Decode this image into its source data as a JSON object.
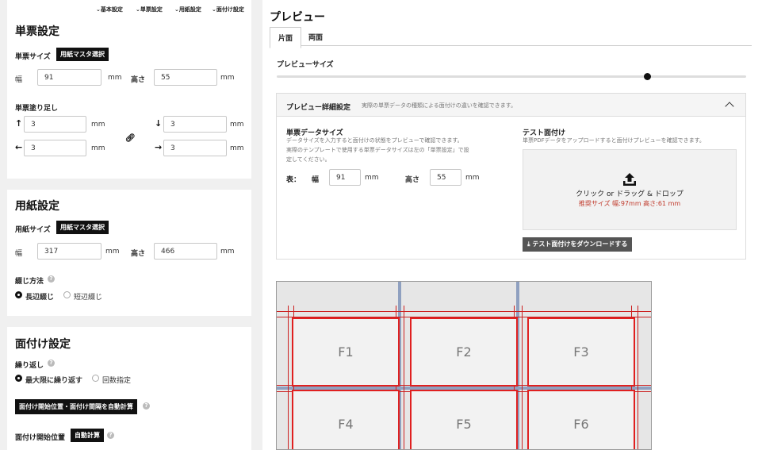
{
  "nav": {
    "basic": "基本設定",
    "ticket": "単票設定",
    "paper": "用紙設定",
    "imposition": "面付け設定"
  },
  "ticket": {
    "title": "単票設定",
    "size_label": "単票サイズ",
    "master_btn": "用紙マスタ選択",
    "width_label": "幅",
    "width_value": "91",
    "height_label": "高さ",
    "height_value": "55",
    "unit": "mm",
    "bleed_label": "単票塗り足し",
    "bleed_top": "3",
    "bleed_bottom": "3",
    "bleed_left": "3",
    "bleed_right": "3"
  },
  "paper": {
    "title": "用紙設定",
    "size_label": "用紙サイズ",
    "master_btn": "用紙マスタ選択",
    "width_label": "幅",
    "width_value": "317",
    "height_label": "高さ",
    "height_value": "466",
    "unit": "mm",
    "binding_label": "綴じ方法",
    "binding_long": "長辺綴じ",
    "binding_short": "短辺綴じ"
  },
  "imposition": {
    "title": "面付け設定",
    "repeat_label": "繰り返し",
    "repeat_max": "最大限に繰り返す",
    "repeat_count": "回数指定",
    "auto_btn": "面付け開始位置・面付け間隔を自動計算",
    "start_label": "面付け開始位置",
    "start_auto_btn": "自動計算"
  },
  "preview": {
    "title": "プレビュー",
    "tab_single": "片面",
    "tab_double": "両面",
    "size_label": "プレビューサイズ",
    "slider_value": 0.79,
    "detail_title": "プレビュー詳細設定",
    "detail_desc": "実際の単票データの種類による面付けの違いを確認できます。",
    "data_size_title": "単票データサイズ",
    "data_size_desc1": "データサイズを入力すると面付けの状態をプレビューで確認できます。",
    "data_size_desc2": "実際のテンプレートで使用する単票データサイズは左の「単票設定」で設",
    "data_size_desc3": "定してください。",
    "front_label": "表：",
    "width_label": "幅",
    "width_value": "91",
    "height_label": "高さ",
    "height_value": "55",
    "unit": "mm",
    "test_title": "テスト面付け",
    "test_desc": "単票PDFデータをアップロードすると面付けプレビューを確認できます。",
    "drop_text": "クリック or ドラッグ & ドロップ",
    "recommend": "推奨サイズ 幅:97mm 高さ:61 mm",
    "download_btn": "テスト面付けをダウンロードする",
    "cells": [
      "F1",
      "F2",
      "F3",
      "F4",
      "F5",
      "F6"
    ]
  },
  "colors": {
    "accent_red": "#e02020",
    "button_black": "#111111",
    "download_btn": "#555555"
  }
}
